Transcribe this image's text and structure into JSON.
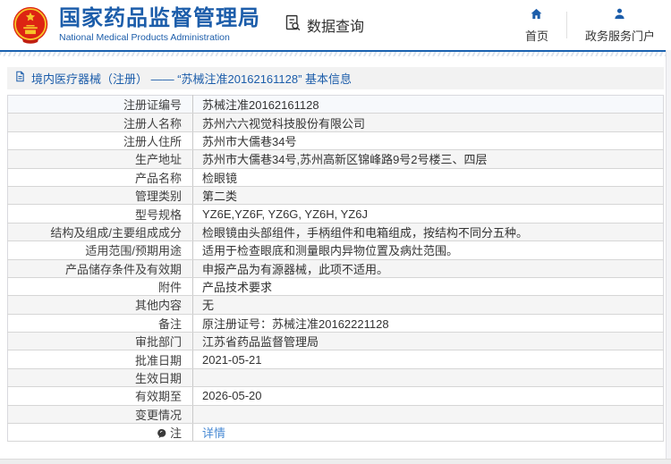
{
  "header": {
    "org_name_cn": "国家药品监督管理局",
    "org_name_en": "National Medical Products Administration",
    "nav_data_query": "数据查询",
    "nav_home": "首页",
    "nav_portal": "政务服务门户"
  },
  "page_title": "境内医疗器械（注册） —— “苏械注准20162161128” 基本信息",
  "table": {
    "rows": [
      {
        "label": "注册证编号",
        "value": "苏械注准20162161128",
        "highlighted": true
      },
      {
        "label": "注册人名称",
        "value": "苏州六六视觉科技股份有限公司"
      },
      {
        "label": "注册人住所",
        "value": "苏州市大儒巷34号"
      },
      {
        "label": "生产地址",
        "value": "苏州市大儒巷34号,苏州高新区锦峰路9号2号楼三、四层"
      },
      {
        "label": "产品名称",
        "value": "检眼镜"
      },
      {
        "label": "管理类别",
        "value": "第二类"
      },
      {
        "label": "型号规格",
        "value": "YZ6E,YZ6F, YZ6G, YZ6H, YZ6J"
      },
      {
        "label": "结构及组成/主要组成成分",
        "value": "检眼镜由头部组件，手柄组件和电箱组成，按结构不同分五种。"
      },
      {
        "label": "适用范围/预期用途",
        "value": "适用于检查眼底和测量眼内异物位置及病灶范围。"
      },
      {
        "label": "产品储存条件及有效期",
        "value": "申报产品为有源器械，此项不适用。"
      },
      {
        "label": "附件",
        "value": "产品技术要求"
      },
      {
        "label": "其他内容",
        "value": "无"
      },
      {
        "label": "备注",
        "value": "原注册证号：苏械注准20162221128"
      },
      {
        "label": "审批部门",
        "value": "江苏省药品监督管理局"
      },
      {
        "label": "批准日期",
        "value": "2021-05-21"
      },
      {
        "label": "生效日期",
        "value": ""
      },
      {
        "label": "有效期至",
        "value": "2026-05-20"
      },
      {
        "label": "变更情况",
        "value": ""
      },
      {
        "label": "注",
        "value": "详情",
        "value_is_link": true,
        "label_icon": "note-balloon-icon"
      }
    ]
  },
  "colors": {
    "brand_blue": "#1c5daa",
    "header_rule_blue": "#1b62b0",
    "link_blue": "#4a8bd4",
    "title_bar_bg": "#f2f2f2",
    "zebra_row_bg": "#f5f5f5",
    "row_border": "#d6d6d6"
  }
}
